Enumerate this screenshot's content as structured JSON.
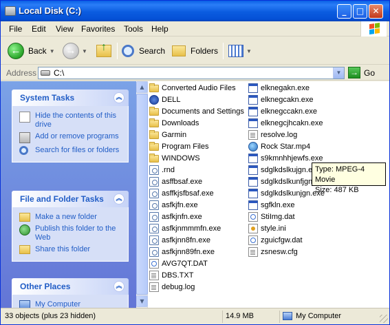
{
  "window": {
    "title": "Local Disk (C:)",
    "controls": {
      "minimize": "_",
      "maximize": "□",
      "close": "✕"
    }
  },
  "menu": [
    {
      "label": "File",
      "accel": "F"
    },
    {
      "label": "Edit",
      "accel": "E"
    },
    {
      "label": "View",
      "accel": "V"
    },
    {
      "label": "Favorites",
      "accel": "a"
    },
    {
      "label": "Tools",
      "accel": "T"
    },
    {
      "label": "Help",
      "accel": "H"
    }
  ],
  "toolbar": {
    "back": "Back",
    "search": "Search",
    "folders": "Folders"
  },
  "address": {
    "label": "Address",
    "value": "C:\\",
    "go": "Go"
  },
  "taskpane": {
    "system_tasks": {
      "title": "System Tasks",
      "items": [
        "Hide the contents of this drive",
        "Add or remove programs",
        "Search for files or folders"
      ]
    },
    "file_tasks": {
      "title": "File and Folder Tasks",
      "items": [
        "Make a new folder",
        "Publish this folder to the Web",
        "Share this folder"
      ]
    },
    "other_places": {
      "title": "Other Places",
      "items": [
        "My Computer"
      ]
    }
  },
  "files": {
    "column1": [
      {
        "name": "Converted Audio Files",
        "type": "folder"
      },
      {
        "name": "DELL",
        "type": "dell"
      },
      {
        "name": "Documents and Settings",
        "type": "folder"
      },
      {
        "name": "Downloads",
        "type": "folder"
      },
      {
        "name": "Garmin",
        "type": "folder"
      },
      {
        "name": "Program Files",
        "type": "folder"
      },
      {
        "name": "WINDOWS",
        "type": "folder"
      },
      {
        "name": ".rnd",
        "type": "unknown"
      },
      {
        "name": "asffbsaf.exe",
        "type": "unknown"
      },
      {
        "name": "asffkjsfbsaf.exe",
        "type": "unknown"
      },
      {
        "name": "asfkjfn.exe",
        "type": "unknown"
      },
      {
        "name": "asfkjnfn.exe",
        "type": "unknown"
      },
      {
        "name": "asfkjnmmmfn.exe",
        "type": "unknown"
      },
      {
        "name": "asfkjnn8fn.exe",
        "type": "unknown"
      },
      {
        "name": "asfkjnn89fn.exe",
        "type": "unknown"
      },
      {
        "name": "AVG7QT.DAT",
        "type": "file"
      },
      {
        "name": "DBS.TXT",
        "type": "doc"
      },
      {
        "name": "debug.log",
        "type": "doc"
      }
    ],
    "column2": [
      {
        "name": "elknegakn.exe",
        "type": "exe"
      },
      {
        "name": "elknegcakn.exe",
        "type": "exe"
      },
      {
        "name": "elknegccakn.exe",
        "type": "exe"
      },
      {
        "name": "elknegcjhcakn.exe",
        "type": "exe"
      },
      {
        "name": "resolve.log",
        "type": "doc"
      },
      {
        "name": "Rock Star.mp4",
        "type": "media"
      },
      {
        "name": "s9kmnhhjewfs.exe",
        "type": "exe"
      },
      {
        "name": "sdglkdslkujgn.exe",
        "type": "exe"
      },
      {
        "name": "sdglkdslkunfjgn.exe",
        "type": "exe"
      },
      {
        "name": "sdglkdslkunjgn.exe",
        "type": "exe"
      },
      {
        "name": "sgfkln.exe",
        "type": "exe"
      },
      {
        "name": "StiImg.dat",
        "type": "file"
      },
      {
        "name": "style.ini",
        "type": "ini"
      },
      {
        "name": "zguicfgw.dat",
        "type": "file"
      },
      {
        "name": "zsnesw.cfg",
        "type": "doc"
      }
    ]
  },
  "tooltip": {
    "line1": "Type: MPEG-4 Movie",
    "line2": "Size: 487 KB"
  },
  "status": {
    "objects": "33 objects (plus 23 hidden)",
    "size": "14.9 MB",
    "location": "My Computer"
  },
  "colors": {
    "titlebar": "#0a5fe6",
    "taskpane": "#7ba2e7",
    "link": "#215dc6"
  }
}
